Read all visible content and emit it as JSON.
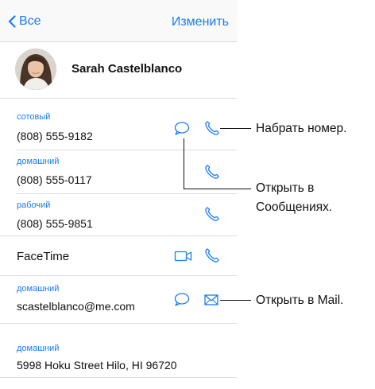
{
  "nav": {
    "back_label": "Все",
    "edit_label": "Изменить"
  },
  "contact": {
    "name": "Sarah Castelblanco"
  },
  "phones": [
    {
      "label": "сотовый",
      "value": "(808) 555-9182"
    },
    {
      "label": "домашний",
      "value": "(808) 555-0117"
    },
    {
      "label": "рабочий",
      "value": "(808) 555-9851"
    }
  ],
  "facetime": {
    "label": "FaceTime"
  },
  "email": {
    "label": "домашний",
    "value": "scastelblanco@me.com"
  },
  "address": {
    "label": "домашний",
    "value": "5998 Hoku Street Hilo, HI 96720"
  },
  "callouts": {
    "dial": "Набрать номер.",
    "messages_line1": "Открыть в",
    "messages_line2": "Сообщениях.",
    "mail": "Открыть в Mail."
  },
  "colors": {
    "accent": "#1a7cf5",
    "separator": "#dcdce0"
  }
}
